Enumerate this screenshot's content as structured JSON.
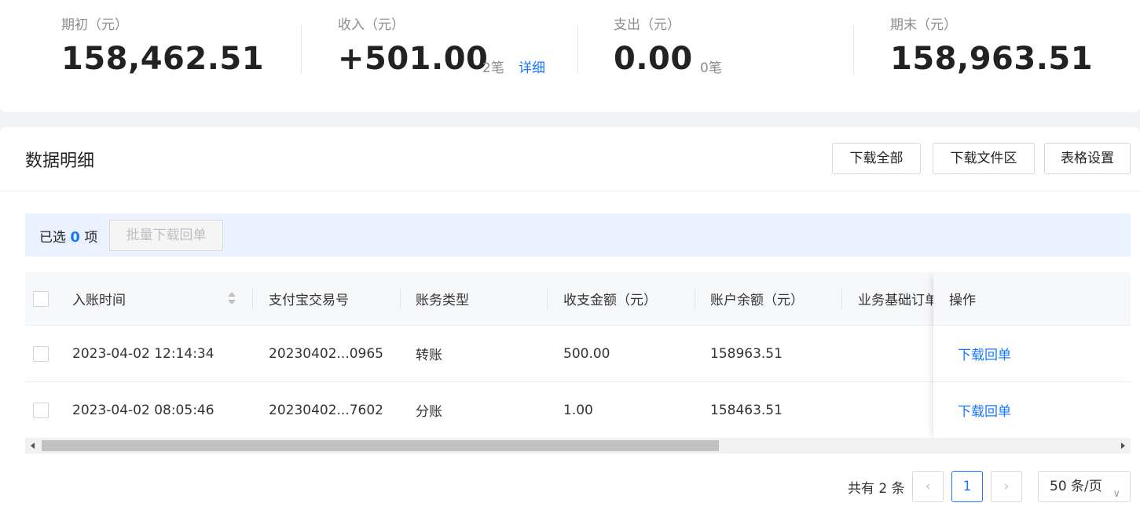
{
  "summary": {
    "opening": {
      "label": "期初（元）",
      "value": "158,462.51"
    },
    "income": {
      "label": "收入（元）",
      "value": "+501.00",
      "count": "2笔",
      "detail_link": "详细"
    },
    "expense": {
      "label": "支出（元）",
      "value": "0.00",
      "count": "0笔"
    },
    "closing": {
      "label": "期末（元）",
      "value": "158,963.51"
    }
  },
  "details": {
    "title": "数据明细",
    "buttons": {
      "download_all": "下载全部",
      "download_area": "下载文件区",
      "table_settings": "表格设置"
    },
    "selection": {
      "prefix": "已选",
      "count": "0",
      "suffix": "项",
      "batch_download": "批量下载回单"
    },
    "columns": [
      "入账时间",
      "支付宝交易号",
      "账务类型",
      "收支金额（元）",
      "账户余额（元）",
      "业务基础订单号",
      "操作"
    ],
    "rows": [
      {
        "time": "2023-04-02 12:14:34",
        "trade_no": "20230402...0965",
        "type": "转账",
        "amount": "500.00",
        "balance": "158963.51",
        "order_no": "",
        "action": "下载回单"
      },
      {
        "time": "2023-04-02 08:05:46",
        "trade_no": "20230402...7602",
        "type": "分账",
        "amount": "1.00",
        "balance": "158463.51",
        "order_no": "",
        "action": "下载回单"
      }
    ],
    "pagination": {
      "total": "共有 2 条",
      "current_page": "1",
      "page_size": "50 条/页"
    }
  },
  "colors": {
    "accent": "#1677ff",
    "selection_bg": "#eaf2ff",
    "header_bg": "#f7f8fa"
  }
}
